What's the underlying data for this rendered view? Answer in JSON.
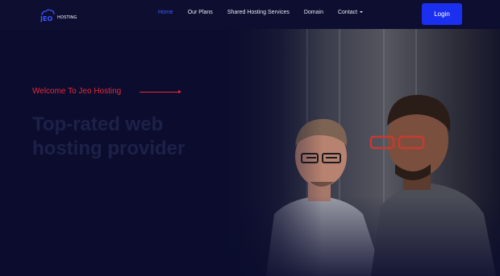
{
  "brand": {
    "logo_letters": "JEO",
    "logo_word": "HOSTING"
  },
  "nav": {
    "items": [
      {
        "label": "Home",
        "active": true
      },
      {
        "label": "Our Plans"
      },
      {
        "label": "Shared Hosting Services"
      },
      {
        "label": "Domain"
      },
      {
        "label": "Contact"
      }
    ],
    "login_label": "Login"
  },
  "hero": {
    "welcome": "Welcome To Jeo Hosting",
    "headline": "Top-rated web hosting provider"
  },
  "colors": {
    "background": "#0c0d2e",
    "accent_blue": "#1a2ff0",
    "active_link": "#3d5bff",
    "welcome_red": "#e5283a",
    "headline": "#1d2147"
  },
  "icons": {
    "logo": "cloud-server-icon",
    "dropdown": "caret-down-icon"
  }
}
